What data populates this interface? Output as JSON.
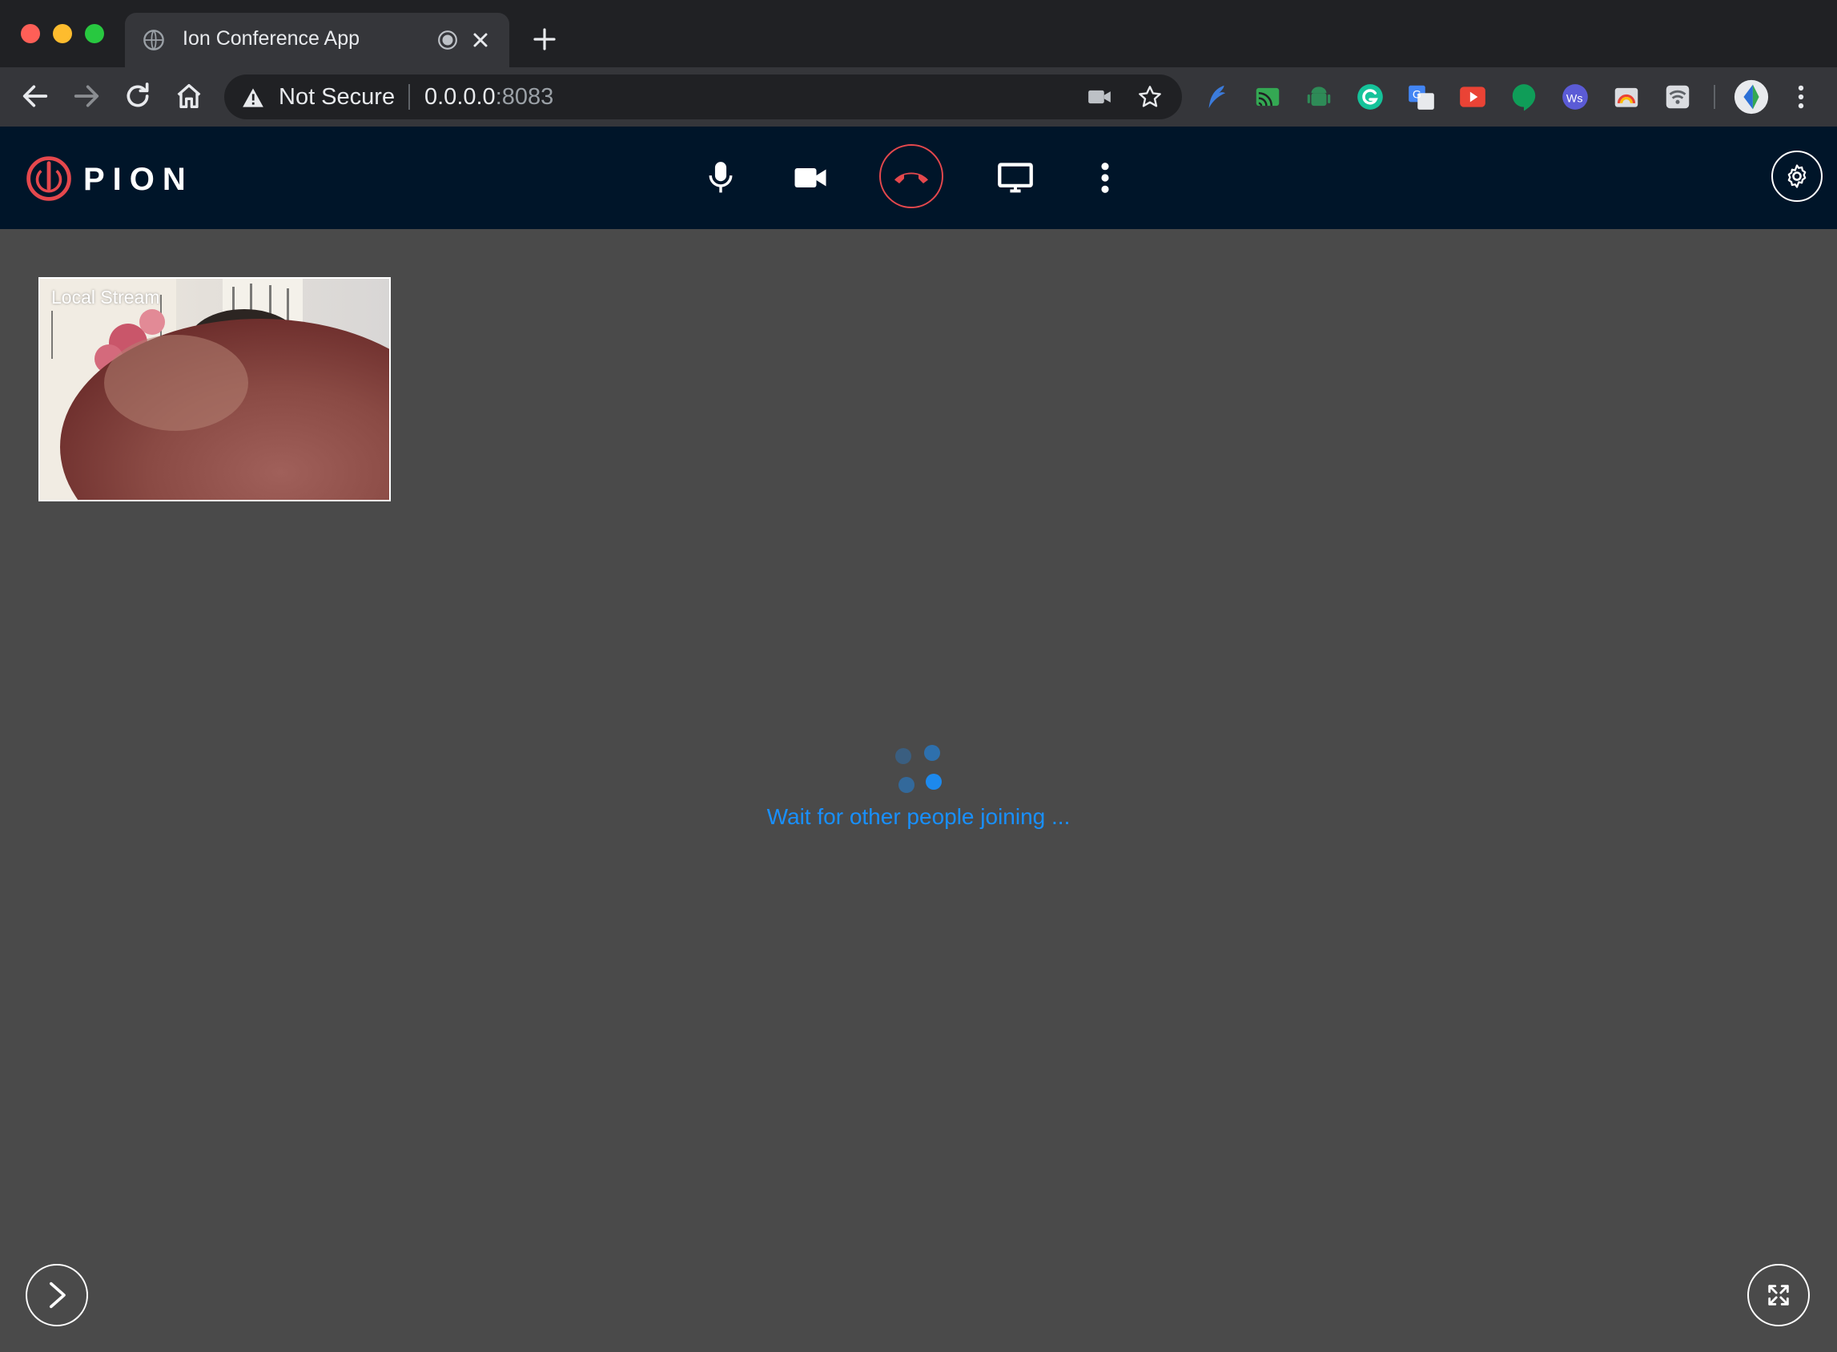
{
  "browser": {
    "tab_title": "Ion Conference App",
    "security_label": "Not Secure",
    "url_host": "0.0.0.0",
    "url_port": ":8083",
    "extensions": [
      {
        "name": "feather-extension-icon",
        "color": "#3b7bdb"
      },
      {
        "name": "cast-extension-icon",
        "color": "#34a853"
      },
      {
        "name": "android-extension-icon",
        "color": "#3ddc84"
      },
      {
        "name": "grammarly-extension-icon",
        "color": "#15c39a"
      },
      {
        "name": "translate-extension-icon",
        "color": "#4285f4"
      },
      {
        "name": "youtube-extension-icon",
        "color": "#ea4335"
      },
      {
        "name": "hangouts-extension-icon",
        "color": "#0f9d58"
      },
      {
        "name": "ws-extension-icon",
        "color": "#5b5bd6"
      },
      {
        "name": "rainbow-extension-icon",
        "color": "#c9c9c9"
      },
      {
        "name": "wifi-extension-icon",
        "color": "#c9c9c9"
      }
    ]
  },
  "app": {
    "logo_text": "PION",
    "brand_color": "#e5484d",
    "header_bg": "#001529",
    "controls": [
      "microphone-icon",
      "video-camera-icon",
      "hang-up-icon",
      "screen-share-icon",
      "more-options-icon"
    ]
  },
  "main": {
    "local_stream_label": "Local Stream",
    "wait_text": "Wait for other people joining ...",
    "accent": "#1890ff"
  }
}
